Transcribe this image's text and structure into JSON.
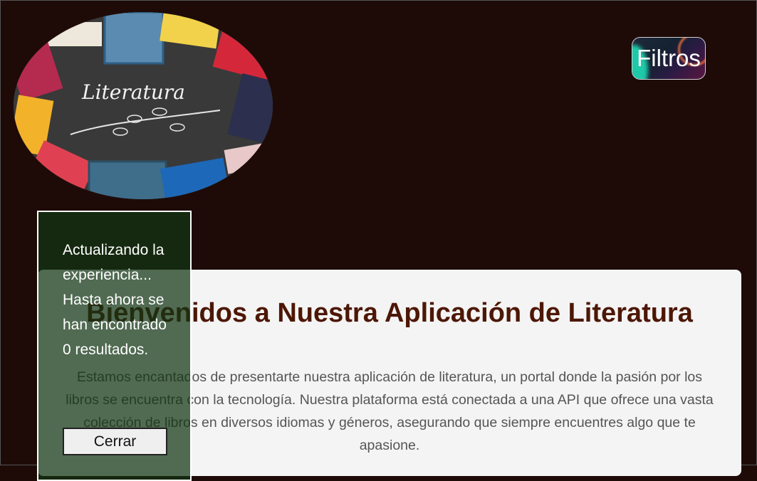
{
  "header": {
    "logo_text": "Literatura",
    "filters_label": "Filtros"
  },
  "main": {
    "title": "Bienvenidos a Nuestra Aplicación de Literatura",
    "intro": "Estamos encantados de presentarte nuestra aplicación de literatura, un portal donde la pasión por los libros se encuentra con la tecnología. Nuestra plataforma está conectada a una API que ofrece una vasta colección de libros en diversos idiomas y géneros, asegurando que siempre encuentres algo que te apasione."
  },
  "toast": {
    "message": "Actualizando la experiencia... Hasta ahora se han encontrado 0 resultados.",
    "close_label": "Cerrar"
  }
}
